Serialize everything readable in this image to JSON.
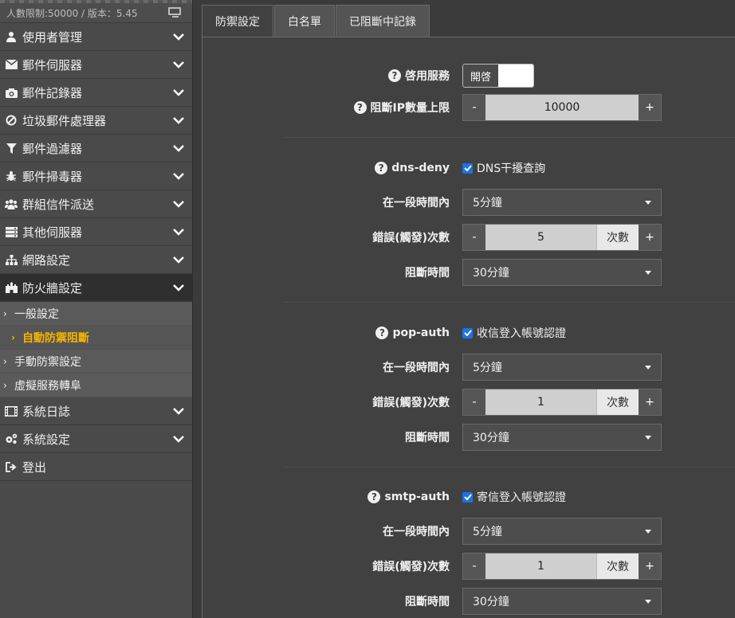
{
  "sidebar": {
    "status": "人數限制:50000 / 版本：5.45",
    "items": [
      {
        "label": "使用者管理"
      },
      {
        "label": "郵件伺服器"
      },
      {
        "label": "郵件記錄器"
      },
      {
        "label": "垃圾郵件處理器"
      },
      {
        "label": "郵件過濾器"
      },
      {
        "label": "郵件掃毒器"
      },
      {
        "label": "群組信件派送"
      },
      {
        "label": "其他伺服器"
      },
      {
        "label": "網路設定"
      },
      {
        "label": "防火牆設定"
      }
    ],
    "submenu": [
      {
        "label": "一般設定"
      },
      {
        "label": "自動防禦阻斷"
      },
      {
        "label": "手動防禦設定"
      },
      {
        "label": "虛擬服務轉阜"
      }
    ],
    "items_after": [
      {
        "label": "系統日誌"
      },
      {
        "label": "系統設定"
      },
      {
        "label": "登出"
      }
    ]
  },
  "tabs": [
    {
      "label": "防禦設定"
    },
    {
      "label": "白名單"
    },
    {
      "label": "已阻斷中記錄"
    }
  ],
  "form": {
    "enable_label": "啓用服務",
    "enable_value": "開啓",
    "max_ip_label": "阻斷IP數量上限",
    "max_ip_value": "10000",
    "minus": "-",
    "plus": "+",
    "sections": [
      {
        "name": "dns-deny",
        "check_label": "DNS干擾查詢",
        "period_label": "在一段時間內",
        "period_value": "5分鐘",
        "errors_label": "錯誤(觸發)次數",
        "errors_value": "5",
        "unit": "次數",
        "block_label": "阻斷時間",
        "block_value": "30分鐘"
      },
      {
        "name": "pop-auth",
        "check_label": "收信登入帳號認證",
        "period_label": "在一段時間內",
        "period_value": "5分鐘",
        "errors_label": "錯誤(觸發)次數",
        "errors_value": "1",
        "unit": "次數",
        "block_label": "阻斷時間",
        "block_value": "30分鐘"
      },
      {
        "name": "smtp-auth",
        "check_label": "寄信登入帳號認證",
        "period_label": "在一段時間內",
        "period_value": "5分鐘",
        "errors_label": "錯誤(觸發)次數",
        "errors_value": "1",
        "unit": "次數",
        "block_label": "阻斷時間",
        "block_value": "30分鐘"
      }
    ]
  }
}
